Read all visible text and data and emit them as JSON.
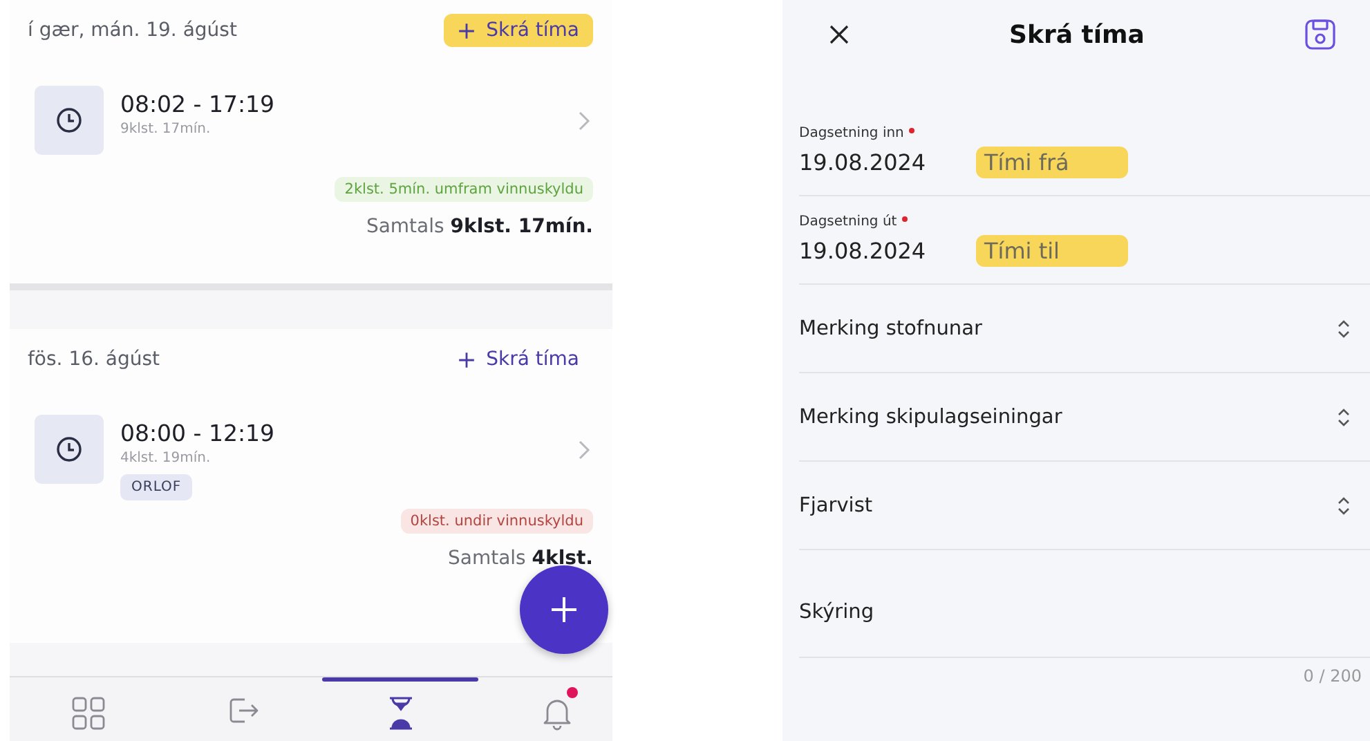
{
  "left": {
    "days": [
      {
        "date": "í gær, mán. 19. ágúst",
        "add_label": "Skrá tíma",
        "add_highlighted": true,
        "entries": [
          {
            "time": "08:02 - 17:19",
            "duration": "9klst. 17mín."
          }
        ],
        "balance": {
          "text": "2klst. 5mín. umfram vinnuskyldu",
          "kind": "over"
        },
        "total": "Samtals **9klst. 17mín.**"
      },
      {
        "date": "fös. 16. ágúst",
        "add_label": "Skrá tíma",
        "add_highlighted": false,
        "entries": [
          {
            "time": "08:00 - 12:19",
            "duration": "4klst. 19mín.",
            "tags": [
              "ORLOF"
            ]
          }
        ],
        "balance": {
          "text": "0klst. undir vinnuskyldu",
          "kind": "under"
        },
        "total": "Samtals **4klst.**"
      }
    ],
    "nav": [
      {
        "kind": "grid",
        "selected": false
      },
      {
        "kind": "logout",
        "selected": false
      },
      {
        "kind": "hourglass",
        "selected": true
      },
      {
        "kind": "bell",
        "selected": false,
        "badge": true
      }
    ]
  },
  "right": {
    "title": "Skrá tíma",
    "fields": [
      {
        "kind": "datetime",
        "label": "Dagsetning inn",
        "required": true,
        "value": "19.08.2024",
        "time_placeholder": "Tími frá",
        "highlighted": true
      },
      {
        "kind": "datetime",
        "label": "Dagsetning út",
        "required": true,
        "value": "19.08.2024",
        "time_placeholder": "Tími til",
        "highlighted": true
      },
      {
        "kind": "select",
        "label": "Merking stofnunar"
      },
      {
        "kind": "select",
        "label": "Merking skipulagseiningar"
      },
      {
        "kind": "select",
        "label": "Fjarvist"
      },
      {
        "kind": "textarea",
        "label": "Skýring",
        "counter": "0 / 200"
      }
    ]
  }
}
